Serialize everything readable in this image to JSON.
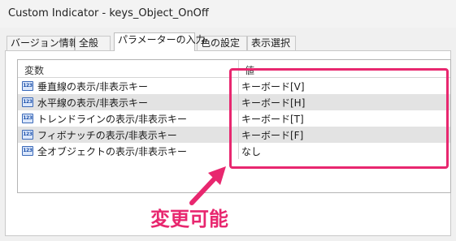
{
  "window": {
    "title": "Custom Indicator - keys_Object_OnOff"
  },
  "tabs": [
    {
      "label": "バージョン情報"
    },
    {
      "label": "全般"
    },
    {
      "label": "パラメーターの入力",
      "active": true
    },
    {
      "label": "色の設定"
    },
    {
      "label": "表示選択"
    }
  ],
  "grid": {
    "header_name": "変数",
    "header_value": "値",
    "icon_label": "123",
    "rows": [
      {
        "name": "垂直線の表示/非表示キー",
        "value": "キーボード[V]"
      },
      {
        "name": "水平線の表示/非表示キー",
        "value": "キーボード[H]"
      },
      {
        "name": "トレンドラインの表示/非表示キー",
        "value": "キーボード[T]"
      },
      {
        "name": "フィボナッチの表示/非表示キー",
        "value": "キーボード[F]"
      },
      {
        "name": "全オブジェクトの表示/非表示キー",
        "value": "なし"
      }
    ]
  },
  "annotation": {
    "text": "変更可能",
    "color": "#e8276f"
  }
}
